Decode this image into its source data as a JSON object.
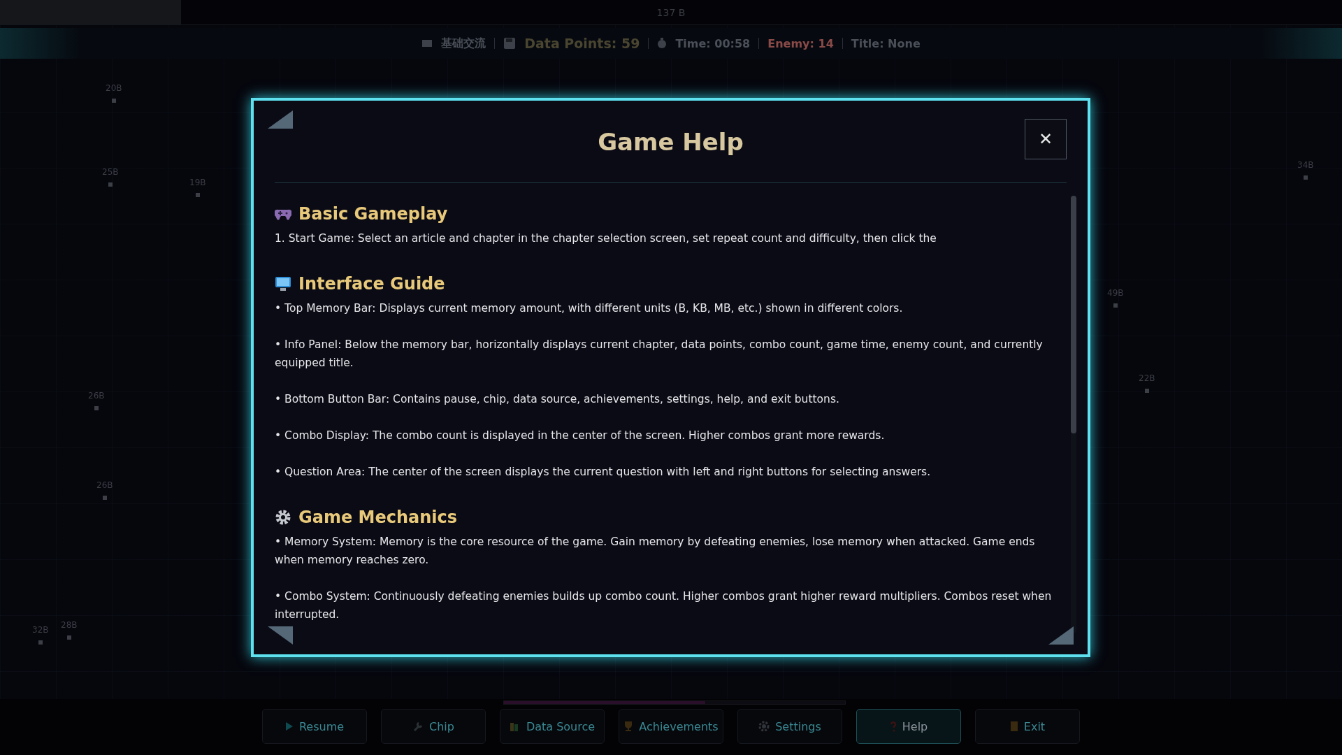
{
  "memory_bar": {
    "reading": "137 B",
    "level": 0.135
  },
  "info_panel": {
    "items": [
      {
        "kind": "chapter",
        "text": "基础交流"
      },
      {
        "kind": "points",
        "text": "Data Points:  59"
      },
      {
        "kind": "time",
        "text": "Time: 00:58"
      },
      {
        "kind": "enemy",
        "text": "Enemy: 14"
      },
      {
        "kind": "title",
        "text": "Title: None"
      }
    ]
  },
  "map_nodes": [
    {
      "label": "20B"
    },
    {
      "label": "25B"
    },
    {
      "label": "19B"
    },
    {
      "label": "26B"
    },
    {
      "label": "26B"
    },
    {
      "label": "32B"
    },
    {
      "label": "28B"
    },
    {
      "label": "34B"
    },
    {
      "label": "49B"
    },
    {
      "label": "22B"
    }
  ],
  "combo_bar": {
    "level": 0.59
  },
  "buttons": [
    {
      "kind": "play",
      "label": "Resume",
      "selected": false
    },
    {
      "kind": "wrench",
      "label": "Chip",
      "selected": false
    },
    {
      "kind": "books",
      "label": "Data Source",
      "selected": false
    },
    {
      "kind": "trophy",
      "label": "Achievements",
      "selected": false
    },
    {
      "kind": "gear",
      "label": "Settings",
      "selected": false
    },
    {
      "kind": "question",
      "label": "Help",
      "selected": true
    },
    {
      "kind": "door",
      "label": "Exit",
      "selected": false
    }
  ],
  "dialog": {
    "title": "Game Help",
    "close": "✕",
    "sections": [
      {
        "kind": "gamepad",
        "heading": "Basic Gameplay",
        "paragraphs": [
          "1. Start Game: Select an article and chapter in the chapter selection screen, set repeat count and difficulty, then click the"
        ]
      },
      {
        "kind": "monitor",
        "heading": "Interface Guide",
        "paragraphs": [
          "• Top Memory Bar: Displays current memory amount, with different units (B, KB, MB, etc.) shown in different colors.",
          "• Info Panel: Below the memory bar, horizontally displays current chapter, data points, combo count, game time, enemy count, and currently equipped title.",
          "• Bottom Button Bar: Contains pause, chip, data source, achievements, settings, help, and exit buttons.",
          "• Combo Display: The combo count is displayed in the center of the screen. Higher combos grant more rewards.",
          "• Question Area: The center of the screen displays the current question with left and right buttons for selecting answers."
        ]
      },
      {
        "kind": "gear",
        "heading": "Game Mechanics",
        "paragraphs": [
          "• Memory System: Memory is the core resource of the game. Gain memory by defeating enemies, lose memory when attacked. Game ends when memory reaches zero.",
          "• Combo System: Continuously defeating enemies builds up combo count. Higher combos grant higher reward multipliers. Combos reset when interrupted."
        ]
      }
    ]
  }
}
